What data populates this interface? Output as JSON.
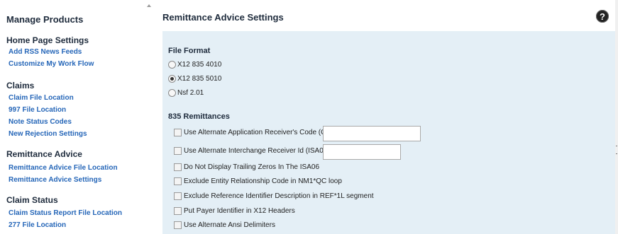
{
  "sidebar": {
    "title": "Manage Products",
    "sections": [
      {
        "heading": "Home Page Settings",
        "links": [
          "Add RSS News Feeds",
          "Customize My Work Flow"
        ]
      },
      {
        "heading": "Claims",
        "links": [
          "Claim File Location",
          "997 File Location",
          "Note Status Codes",
          "New Rejection Settings"
        ]
      },
      {
        "heading": "Remittance Advice",
        "links": [
          "Remittance Advice File Location",
          "Remittance Advice Settings"
        ]
      },
      {
        "heading": "Claim Status",
        "links": [
          "Claim Status Report File Location",
          "277 File Location"
        ]
      }
    ]
  },
  "main": {
    "title": "Remittance Advice Settings",
    "help_icon": "?",
    "file_format": {
      "heading": "File Format",
      "options": [
        {
          "label": "X12 835 4010",
          "selected": false
        },
        {
          "label": "X12 835 5010",
          "selected": true
        },
        {
          "label": "Nsf 2.01",
          "selected": false
        }
      ]
    },
    "remittances": {
      "heading": "835 Remittances",
      "options": [
        {
          "label": "Use Alternate Application Receiver's Code (GS03)",
          "checked": false,
          "value": ""
        },
        {
          "label": "Use Alternate Interchange Receiver Id (ISA08)",
          "checked": false,
          "value": ""
        },
        {
          "label": "Do Not Display Trailing Zeros In The ISA06",
          "checked": false
        },
        {
          "label": "Exclude Entity Relationship Code in NM1*QC loop",
          "checked": false
        },
        {
          "label": "Exclude Reference Identifier Description in REF*1L segment",
          "checked": false
        },
        {
          "label": "Put Payer Identifier in X12 Headers",
          "checked": false
        },
        {
          "label": "Use Alternate Ansi Delimiters",
          "checked": false
        }
      ]
    }
  }
}
